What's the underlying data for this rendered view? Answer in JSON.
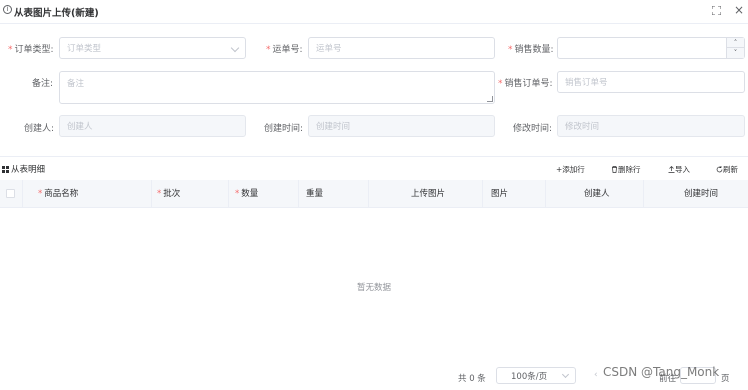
{
  "dialog": {
    "title": "从表图片上传(新建)",
    "info_icon": "info-icon",
    "fullscreen_icon": "fullscreen-icon",
    "close_icon": "close-icon",
    "close_glyph": "×",
    "info_glyph": "i"
  },
  "form": {
    "order_type": {
      "label": "订单类型:",
      "placeholder": "订单类型",
      "required": true
    },
    "waybill_no": {
      "label": "运单号:",
      "placeholder": "运单号",
      "required": true
    },
    "sales_qty": {
      "label": "销售数量:",
      "placeholder": "",
      "required": true
    },
    "remark": {
      "label": "备注:",
      "placeholder": "备注"
    },
    "sales_order_no": {
      "label": "销售订单号:",
      "placeholder": "销售订单号",
      "required": true
    },
    "creator": {
      "label": "创建人:",
      "placeholder": "创建人"
    },
    "created_time": {
      "label": "创建时间:",
      "placeholder": "创建时间"
    },
    "modified_time": {
      "label": "修改时间:",
      "placeholder": "修改时间"
    }
  },
  "detail": {
    "title": "从表明细",
    "toolbar": {
      "add_row": "+添加行",
      "delete_row": "删除行",
      "import": "导入",
      "refresh": "刷新"
    },
    "columns": [
      {
        "label": "商品名称",
        "required": true
      },
      {
        "label": "批次",
        "required": true
      },
      {
        "label": "数量",
        "required": true
      },
      {
        "label": "重量",
        "required": false
      },
      {
        "label": "上传图片",
        "required": false
      },
      {
        "label": "图片",
        "required": false
      },
      {
        "label": "创建人",
        "required": false
      },
      {
        "label": "创建时间",
        "required": false
      }
    ],
    "empty_text": "暂无数据"
  },
  "pagination": {
    "total": "共 0 条",
    "page_size": "100条/页",
    "prev": "‹",
    "next": "›",
    "goto": "前往",
    "page": "页"
  },
  "watermark": "CSDN @Tang_Monk",
  "stepper": {
    "up": "˄",
    "down": "˅"
  },
  "required_mark": "*"
}
